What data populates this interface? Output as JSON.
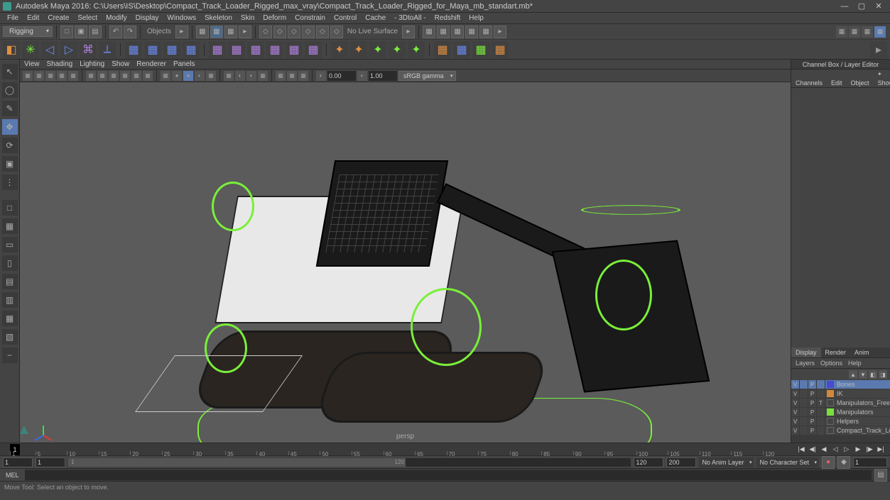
{
  "title": "Autodesk Maya 2016: C:\\Users\\IS\\Desktop\\Compact_Track_Loader_Rigged_max_vray\\Compact_Track_Loader_Rigged_for_Maya_mb_standart.mb*",
  "menu": [
    "File",
    "Edit",
    "Create",
    "Select",
    "Modify",
    "Display",
    "Windows",
    "Skeleton",
    "Skin",
    "Deform",
    "Constrain",
    "Control",
    "Cache",
    "- 3DtoAll -",
    "Redshift",
    "Help"
  ],
  "module_dropdown": "Rigging",
  "object_mode": "Objects",
  "live_surface": "No Live Surface",
  "viewport_menu": [
    "View",
    "Shading",
    "Lighting",
    "Show",
    "Renderer",
    "Panels"
  ],
  "near_clip": "0.00",
  "far_clip": "1.00",
  "color_space": "sRGB gamma",
  "camera_label": "persp",
  "channel_box": {
    "header": "Channel Box / Layer Editor",
    "tabs": [
      "Channels",
      "Edit",
      "Object",
      "Show"
    ]
  },
  "layer_editor": {
    "tabs": [
      "Display",
      "Render",
      "Anim"
    ],
    "active_tab": "Display",
    "menu": [
      "Layers",
      "Options",
      "Help"
    ],
    "layers": [
      {
        "v": "V",
        "r": "",
        "p": "P",
        "t": "",
        "color": "#4a4ad0",
        "name": "Bones",
        "selected": true
      },
      {
        "v": "V",
        "r": "",
        "p": "P",
        "t": "",
        "color": "#d08a3a",
        "name": "IK",
        "selected": false
      },
      {
        "v": "V",
        "r": "",
        "p": "P",
        "t": "T",
        "color": "",
        "name": "Manipulators_Freez",
        "selected": false
      },
      {
        "v": "V",
        "r": "",
        "p": "P",
        "t": "",
        "color": "#7ae03a",
        "name": "Manipulators",
        "selected": false
      },
      {
        "v": "V",
        "r": "",
        "p": "P",
        "t": "",
        "color": "",
        "name": "Helpers",
        "selected": false
      },
      {
        "v": "V",
        "r": "",
        "p": "P",
        "t": "",
        "color": "",
        "name": "Compact_Track_Load",
        "selected": false
      }
    ]
  },
  "timeline": {
    "current_frame": "1",
    "ticks": [
      1,
      5,
      10,
      15,
      20,
      25,
      30,
      35,
      40,
      45,
      50,
      55,
      60,
      65,
      70,
      75,
      80,
      85,
      90,
      95,
      100,
      105,
      110,
      115,
      120
    ],
    "range_start_outer": "1",
    "range_start_inner": "1",
    "range_end_inner": "120",
    "range_end_outer": "200",
    "inner_label_start": "1",
    "inner_label_end": "120",
    "anim_layer": "No Anim Layer",
    "character_set": "No Character Set",
    "frame_display": "1"
  },
  "cmd_label": "MEL",
  "help_text": "Move Tool: Select an object to move."
}
